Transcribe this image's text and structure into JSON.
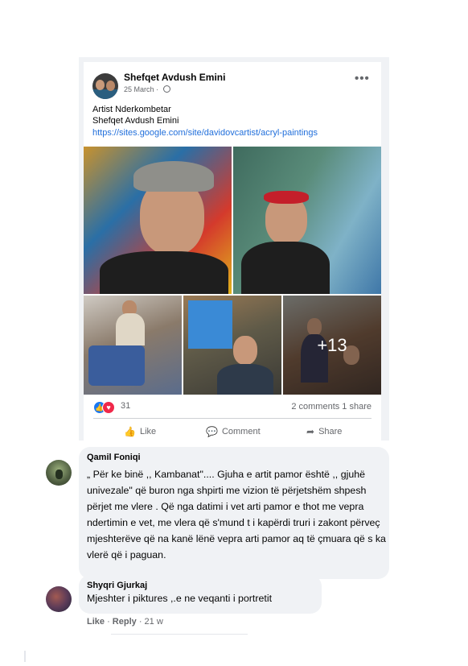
{
  "post": {
    "author": "Shefqet Avdush Emini",
    "date": "25 March",
    "text_line1": "Artist Nderkombetar",
    "text_line2": "Shefqet Avdush Emini",
    "link": "https://sites.google.com/site/davidovcartist/acryl-paintings",
    "more_label": "•••",
    "photos_more_count": "+13",
    "reaction_count": "31",
    "comments_shares": "2 comments  1 share",
    "actions": {
      "like": "Like",
      "comment": "Comment",
      "share": "Share"
    }
  },
  "comments": [
    {
      "name": "Qamil Foniqi",
      "text": "„ Për ke binë ,, Kambanat\".... Gjuha e artit pamor është ,, gjuhë univezale\" që buron nga shpirti me vizion të përjetshëm shpesh përjet me vlere . Që nga datimi i vet arti pamor e thot me vepra ndertimin e vet, me vlera që s'mund t i kapërdi truri i zakont përveç mjeshterëve që na kanë lënë vepra arti pamor aq të çmuara që s ka vlerë që i paguan."
    },
    {
      "name": "Shyqri Gjurkaj",
      "text": "Mjeshter i piktures ,.e ne veqanti i portretit"
    }
  ],
  "comment_meta": {
    "like": "Like",
    "reply": "Reply",
    "age": "21 w"
  },
  "colors": {
    "link": "#216fdb",
    "like_blue": "#1877f2",
    "love_red": "#f0284a",
    "bubble": "#f0f2f5"
  }
}
